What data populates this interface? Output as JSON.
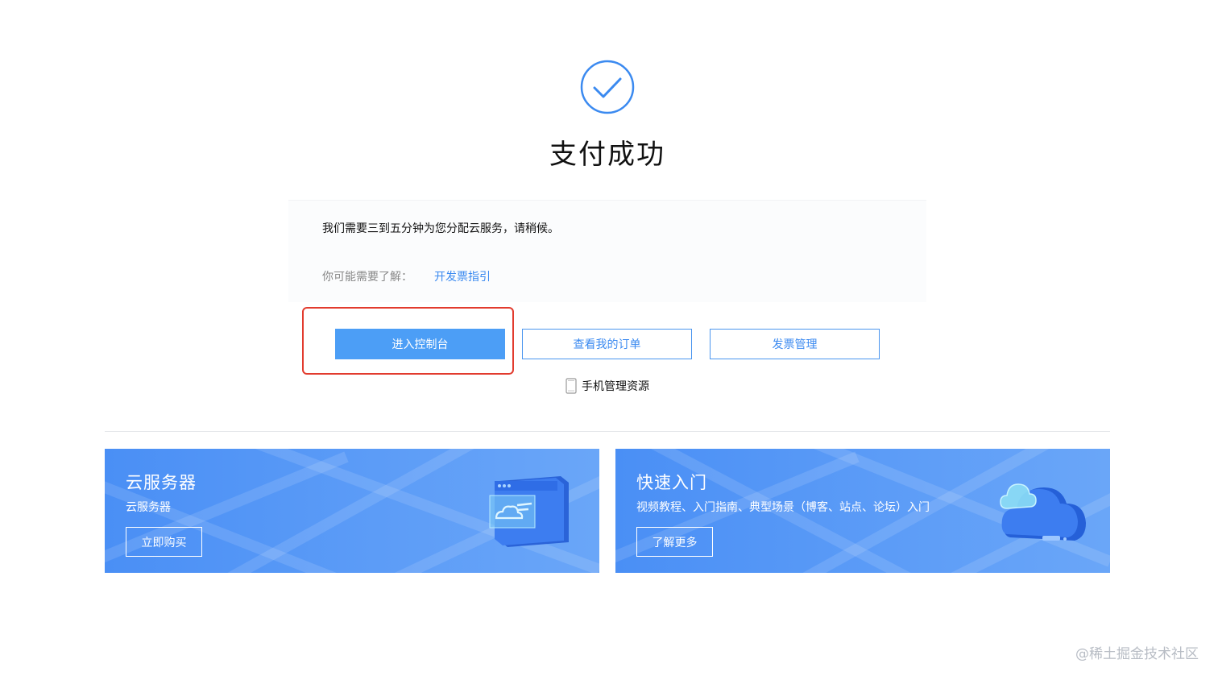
{
  "status": {
    "title": "支付成功",
    "icon": "check-circle-icon",
    "accent_color": "#3b8af0"
  },
  "notice": {
    "message": "我们需要三到五分钟为您分配云服务，请稍候。",
    "hint_label": "你可能需要了解：",
    "hint_link": "开发票指引"
  },
  "actions": {
    "console_label": "进入控制台",
    "orders_label": "查看我的订单",
    "invoice_label": "发票管理",
    "mobile_label": "手机管理资源",
    "mobile_icon": "phone-icon"
  },
  "promos": [
    {
      "title": "云服务器",
      "subtitle": "云服务器",
      "button": "立即购买",
      "icon": "cloud-server-window-icon"
    },
    {
      "title": "快速入门",
      "subtitle": "视频教程、入门指南、典型场景（博客、站点、论坛）入门",
      "button": "了解更多",
      "icon": "cloud-storage-icon"
    }
  ],
  "watermark": "@稀土掘金技术社区",
  "colors": {
    "primary_button": "#4c9ef6",
    "highlight": "#e23b2e",
    "banner": "#5c9cf7"
  }
}
